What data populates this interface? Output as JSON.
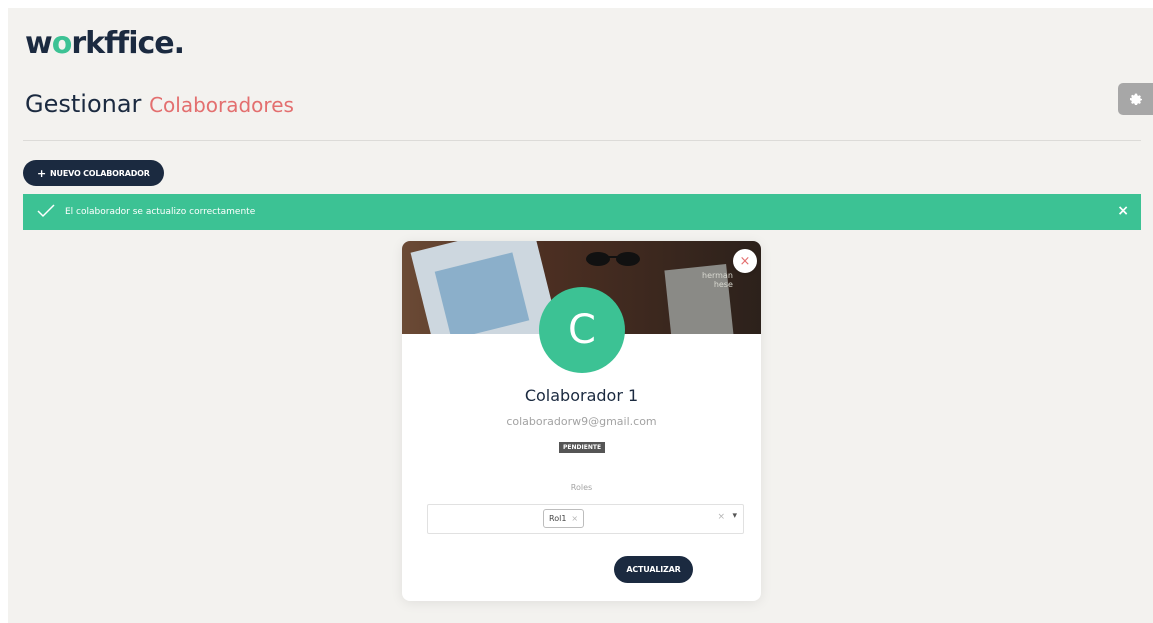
{
  "brand": {
    "logo_left": "w",
    "logo_right": "rkffice.",
    "logo_dot": "o"
  },
  "header": {
    "title_main": "Gestionar",
    "title_accent": "Colaboradores"
  },
  "toolbar": {
    "new_button_label": "NUEVO COLABORADOR",
    "new_button_icon": "+"
  },
  "alert": {
    "message": "El colaborador se actualizo correctamente",
    "close_symbol": "×",
    "check_symbol": "✓"
  },
  "card": {
    "avatar_initial": "C",
    "name": "Colaborador 1",
    "email": "colaboradorw9@gmail.com",
    "status_badge": "PENDIENTE",
    "close_symbol": "×",
    "cover_text": "herman\nhese",
    "roles_label": "Roles",
    "roles_selected": [
      "Rol1"
    ],
    "chip_remove": "×",
    "select_clear": "×",
    "select_caret": "▾",
    "update_button_label": "ACTUALIZAR"
  },
  "colors": {
    "accent_green": "#3cc294",
    "navy": "#1b2a40",
    "coral": "#e36f6f"
  }
}
